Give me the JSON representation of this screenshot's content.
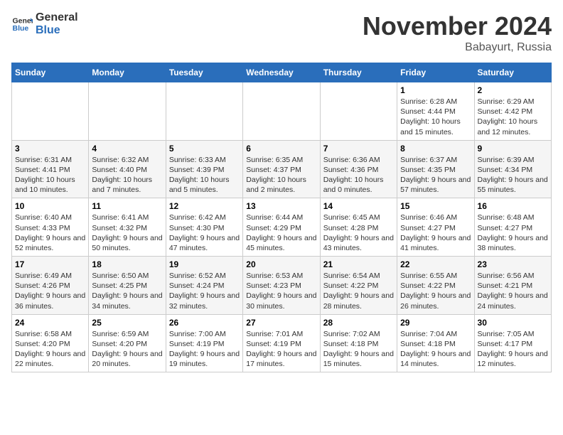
{
  "header": {
    "logo_general": "General",
    "logo_blue": "Blue",
    "month_title": "November 2024",
    "subtitle": "Babayurt, Russia"
  },
  "days_of_week": [
    "Sunday",
    "Monday",
    "Tuesday",
    "Wednesday",
    "Thursday",
    "Friday",
    "Saturday"
  ],
  "weeks": [
    [
      {
        "day": "",
        "info": ""
      },
      {
        "day": "",
        "info": ""
      },
      {
        "day": "",
        "info": ""
      },
      {
        "day": "",
        "info": ""
      },
      {
        "day": "",
        "info": ""
      },
      {
        "day": "1",
        "info": "Sunrise: 6:28 AM\nSunset: 4:44 PM\nDaylight: 10 hours and 15 minutes."
      },
      {
        "day": "2",
        "info": "Sunrise: 6:29 AM\nSunset: 4:42 PM\nDaylight: 10 hours and 12 minutes."
      }
    ],
    [
      {
        "day": "3",
        "info": "Sunrise: 6:31 AM\nSunset: 4:41 PM\nDaylight: 10 hours and 10 minutes."
      },
      {
        "day": "4",
        "info": "Sunrise: 6:32 AM\nSunset: 4:40 PM\nDaylight: 10 hours and 7 minutes."
      },
      {
        "day": "5",
        "info": "Sunrise: 6:33 AM\nSunset: 4:39 PM\nDaylight: 10 hours and 5 minutes."
      },
      {
        "day": "6",
        "info": "Sunrise: 6:35 AM\nSunset: 4:37 PM\nDaylight: 10 hours and 2 minutes."
      },
      {
        "day": "7",
        "info": "Sunrise: 6:36 AM\nSunset: 4:36 PM\nDaylight: 10 hours and 0 minutes."
      },
      {
        "day": "8",
        "info": "Sunrise: 6:37 AM\nSunset: 4:35 PM\nDaylight: 9 hours and 57 minutes."
      },
      {
        "day": "9",
        "info": "Sunrise: 6:39 AM\nSunset: 4:34 PM\nDaylight: 9 hours and 55 minutes."
      }
    ],
    [
      {
        "day": "10",
        "info": "Sunrise: 6:40 AM\nSunset: 4:33 PM\nDaylight: 9 hours and 52 minutes."
      },
      {
        "day": "11",
        "info": "Sunrise: 6:41 AM\nSunset: 4:32 PM\nDaylight: 9 hours and 50 minutes."
      },
      {
        "day": "12",
        "info": "Sunrise: 6:42 AM\nSunset: 4:30 PM\nDaylight: 9 hours and 47 minutes."
      },
      {
        "day": "13",
        "info": "Sunrise: 6:44 AM\nSunset: 4:29 PM\nDaylight: 9 hours and 45 minutes."
      },
      {
        "day": "14",
        "info": "Sunrise: 6:45 AM\nSunset: 4:28 PM\nDaylight: 9 hours and 43 minutes."
      },
      {
        "day": "15",
        "info": "Sunrise: 6:46 AM\nSunset: 4:27 PM\nDaylight: 9 hours and 41 minutes."
      },
      {
        "day": "16",
        "info": "Sunrise: 6:48 AM\nSunset: 4:27 PM\nDaylight: 9 hours and 38 minutes."
      }
    ],
    [
      {
        "day": "17",
        "info": "Sunrise: 6:49 AM\nSunset: 4:26 PM\nDaylight: 9 hours and 36 minutes."
      },
      {
        "day": "18",
        "info": "Sunrise: 6:50 AM\nSunset: 4:25 PM\nDaylight: 9 hours and 34 minutes."
      },
      {
        "day": "19",
        "info": "Sunrise: 6:52 AM\nSunset: 4:24 PM\nDaylight: 9 hours and 32 minutes."
      },
      {
        "day": "20",
        "info": "Sunrise: 6:53 AM\nSunset: 4:23 PM\nDaylight: 9 hours and 30 minutes."
      },
      {
        "day": "21",
        "info": "Sunrise: 6:54 AM\nSunset: 4:22 PM\nDaylight: 9 hours and 28 minutes."
      },
      {
        "day": "22",
        "info": "Sunrise: 6:55 AM\nSunset: 4:22 PM\nDaylight: 9 hours and 26 minutes."
      },
      {
        "day": "23",
        "info": "Sunrise: 6:56 AM\nSunset: 4:21 PM\nDaylight: 9 hours and 24 minutes."
      }
    ],
    [
      {
        "day": "24",
        "info": "Sunrise: 6:58 AM\nSunset: 4:20 PM\nDaylight: 9 hours and 22 minutes."
      },
      {
        "day": "25",
        "info": "Sunrise: 6:59 AM\nSunset: 4:20 PM\nDaylight: 9 hours and 20 minutes."
      },
      {
        "day": "26",
        "info": "Sunrise: 7:00 AM\nSunset: 4:19 PM\nDaylight: 9 hours and 19 minutes."
      },
      {
        "day": "27",
        "info": "Sunrise: 7:01 AM\nSunset: 4:19 PM\nDaylight: 9 hours and 17 minutes."
      },
      {
        "day": "28",
        "info": "Sunrise: 7:02 AM\nSunset: 4:18 PM\nDaylight: 9 hours and 15 minutes."
      },
      {
        "day": "29",
        "info": "Sunrise: 7:04 AM\nSunset: 4:18 PM\nDaylight: 9 hours and 14 minutes."
      },
      {
        "day": "30",
        "info": "Sunrise: 7:05 AM\nSunset: 4:17 PM\nDaylight: 9 hours and 12 minutes."
      }
    ]
  ]
}
